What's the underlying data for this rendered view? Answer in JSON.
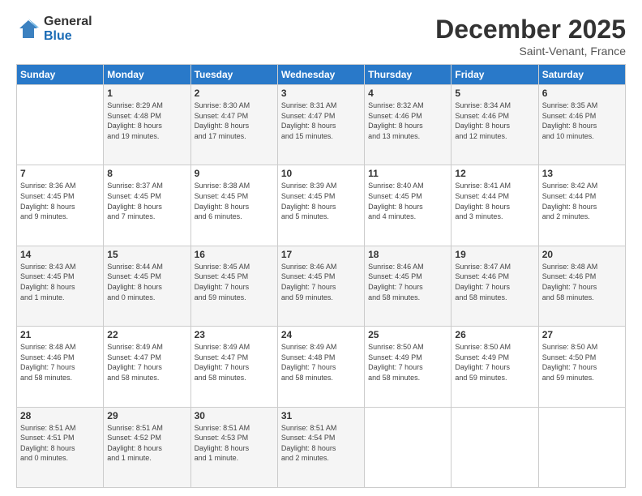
{
  "header": {
    "logo_general": "General",
    "logo_blue": "Blue",
    "month_title": "December 2025",
    "location": "Saint-Venant, France"
  },
  "days_of_week": [
    "Sunday",
    "Monday",
    "Tuesday",
    "Wednesday",
    "Thursday",
    "Friday",
    "Saturday"
  ],
  "weeks": [
    [
      {
        "day": "",
        "info": ""
      },
      {
        "day": "1",
        "info": "Sunrise: 8:29 AM\nSunset: 4:48 PM\nDaylight: 8 hours\nand 19 minutes."
      },
      {
        "day": "2",
        "info": "Sunrise: 8:30 AM\nSunset: 4:47 PM\nDaylight: 8 hours\nand 17 minutes."
      },
      {
        "day": "3",
        "info": "Sunrise: 8:31 AM\nSunset: 4:47 PM\nDaylight: 8 hours\nand 15 minutes."
      },
      {
        "day": "4",
        "info": "Sunrise: 8:32 AM\nSunset: 4:46 PM\nDaylight: 8 hours\nand 13 minutes."
      },
      {
        "day": "5",
        "info": "Sunrise: 8:34 AM\nSunset: 4:46 PM\nDaylight: 8 hours\nand 12 minutes."
      },
      {
        "day": "6",
        "info": "Sunrise: 8:35 AM\nSunset: 4:46 PM\nDaylight: 8 hours\nand 10 minutes."
      }
    ],
    [
      {
        "day": "7",
        "info": "Sunrise: 8:36 AM\nSunset: 4:45 PM\nDaylight: 8 hours\nand 9 minutes."
      },
      {
        "day": "8",
        "info": "Sunrise: 8:37 AM\nSunset: 4:45 PM\nDaylight: 8 hours\nand 7 minutes."
      },
      {
        "day": "9",
        "info": "Sunrise: 8:38 AM\nSunset: 4:45 PM\nDaylight: 8 hours\nand 6 minutes."
      },
      {
        "day": "10",
        "info": "Sunrise: 8:39 AM\nSunset: 4:45 PM\nDaylight: 8 hours\nand 5 minutes."
      },
      {
        "day": "11",
        "info": "Sunrise: 8:40 AM\nSunset: 4:45 PM\nDaylight: 8 hours\nand 4 minutes."
      },
      {
        "day": "12",
        "info": "Sunrise: 8:41 AM\nSunset: 4:44 PM\nDaylight: 8 hours\nand 3 minutes."
      },
      {
        "day": "13",
        "info": "Sunrise: 8:42 AM\nSunset: 4:44 PM\nDaylight: 8 hours\nand 2 minutes."
      }
    ],
    [
      {
        "day": "14",
        "info": "Sunrise: 8:43 AM\nSunset: 4:45 PM\nDaylight: 8 hours\nand 1 minute."
      },
      {
        "day": "15",
        "info": "Sunrise: 8:44 AM\nSunset: 4:45 PM\nDaylight: 8 hours\nand 0 minutes."
      },
      {
        "day": "16",
        "info": "Sunrise: 8:45 AM\nSunset: 4:45 PM\nDaylight: 7 hours\nand 59 minutes."
      },
      {
        "day": "17",
        "info": "Sunrise: 8:46 AM\nSunset: 4:45 PM\nDaylight: 7 hours\nand 59 minutes."
      },
      {
        "day": "18",
        "info": "Sunrise: 8:46 AM\nSunset: 4:45 PM\nDaylight: 7 hours\nand 58 minutes."
      },
      {
        "day": "19",
        "info": "Sunrise: 8:47 AM\nSunset: 4:46 PM\nDaylight: 7 hours\nand 58 minutes."
      },
      {
        "day": "20",
        "info": "Sunrise: 8:48 AM\nSunset: 4:46 PM\nDaylight: 7 hours\nand 58 minutes."
      }
    ],
    [
      {
        "day": "21",
        "info": "Sunrise: 8:48 AM\nSunset: 4:46 PM\nDaylight: 7 hours\nand 58 minutes."
      },
      {
        "day": "22",
        "info": "Sunrise: 8:49 AM\nSunset: 4:47 PM\nDaylight: 7 hours\nand 58 minutes."
      },
      {
        "day": "23",
        "info": "Sunrise: 8:49 AM\nSunset: 4:47 PM\nDaylight: 7 hours\nand 58 minutes."
      },
      {
        "day": "24",
        "info": "Sunrise: 8:49 AM\nSunset: 4:48 PM\nDaylight: 7 hours\nand 58 minutes."
      },
      {
        "day": "25",
        "info": "Sunrise: 8:50 AM\nSunset: 4:49 PM\nDaylight: 7 hours\nand 58 minutes."
      },
      {
        "day": "26",
        "info": "Sunrise: 8:50 AM\nSunset: 4:49 PM\nDaylight: 7 hours\nand 59 minutes."
      },
      {
        "day": "27",
        "info": "Sunrise: 8:50 AM\nSunset: 4:50 PM\nDaylight: 7 hours\nand 59 minutes."
      }
    ],
    [
      {
        "day": "28",
        "info": "Sunrise: 8:51 AM\nSunset: 4:51 PM\nDaylight: 8 hours\nand 0 minutes."
      },
      {
        "day": "29",
        "info": "Sunrise: 8:51 AM\nSunset: 4:52 PM\nDaylight: 8 hours\nand 1 minute."
      },
      {
        "day": "30",
        "info": "Sunrise: 8:51 AM\nSunset: 4:53 PM\nDaylight: 8 hours\nand 1 minute."
      },
      {
        "day": "31",
        "info": "Sunrise: 8:51 AM\nSunset: 4:54 PM\nDaylight: 8 hours\nand 2 minutes."
      },
      {
        "day": "",
        "info": ""
      },
      {
        "day": "",
        "info": ""
      },
      {
        "day": "",
        "info": ""
      }
    ]
  ]
}
